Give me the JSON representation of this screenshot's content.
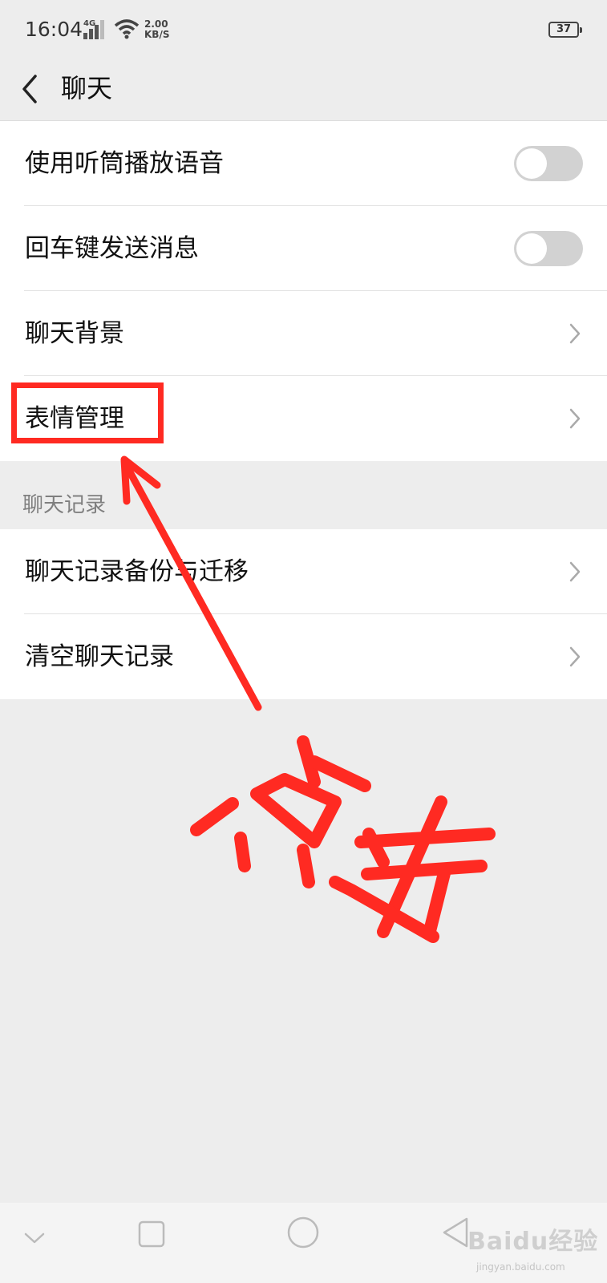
{
  "status_bar": {
    "time": "16:04",
    "network": "4G",
    "speed_value": "2.00",
    "speed_unit": "KB/S",
    "battery": "37"
  },
  "nav": {
    "title": "聊天",
    "back_icon": "chevron-left-icon"
  },
  "groups": [
    {
      "items": [
        {
          "label": "使用听筒播放语音",
          "control": "toggle",
          "checked": false
        },
        {
          "label": "回车键发送消息",
          "control": "toggle",
          "checked": false
        },
        {
          "label": "聊天背景",
          "control": "chevron"
        },
        {
          "label": "表情管理",
          "control": "chevron"
        }
      ]
    },
    {
      "header": "聊天记录",
      "items": [
        {
          "label": "聊天记录备份与迁移",
          "control": "chevron"
        },
        {
          "label": "清空聊天记录",
          "control": "chevron"
        }
      ]
    }
  ],
  "annotation": {
    "text": "点击",
    "color": "#ff2a22"
  },
  "system_nav": {
    "buttons": [
      "down-icon",
      "square-icon",
      "circle-icon",
      "back-triangle-icon"
    ]
  },
  "watermark": {
    "logo": "Baidu经验",
    "url": "jingyan.baidu.com"
  }
}
